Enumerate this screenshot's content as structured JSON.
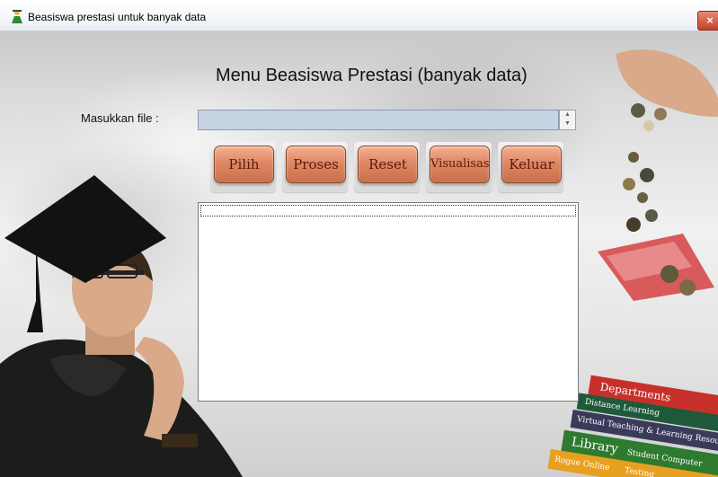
{
  "window": {
    "title": "Beasiswa prestasi untuk banyak data",
    "close_label": "×",
    "app_icon": "scholarship-app-icon"
  },
  "main": {
    "heading": "Menu Beasiswa Prestasi (banyak data)",
    "file_label": "Masukkan file  :",
    "file_value": "",
    "buttons": [
      "Pilih",
      "Proses",
      "Reset",
      "Visualisasi",
      "Keluar"
    ]
  },
  "decoration": {
    "book_labels": [
      "Departments",
      "Distance Learning",
      "Virtual Teaching & Learning Resou",
      "Library",
      "Student Computer",
      "Rogue Online",
      "Testing"
    ]
  },
  "colors": {
    "button_accent": "#de8461",
    "input_bg": "#c5d3e3"
  }
}
